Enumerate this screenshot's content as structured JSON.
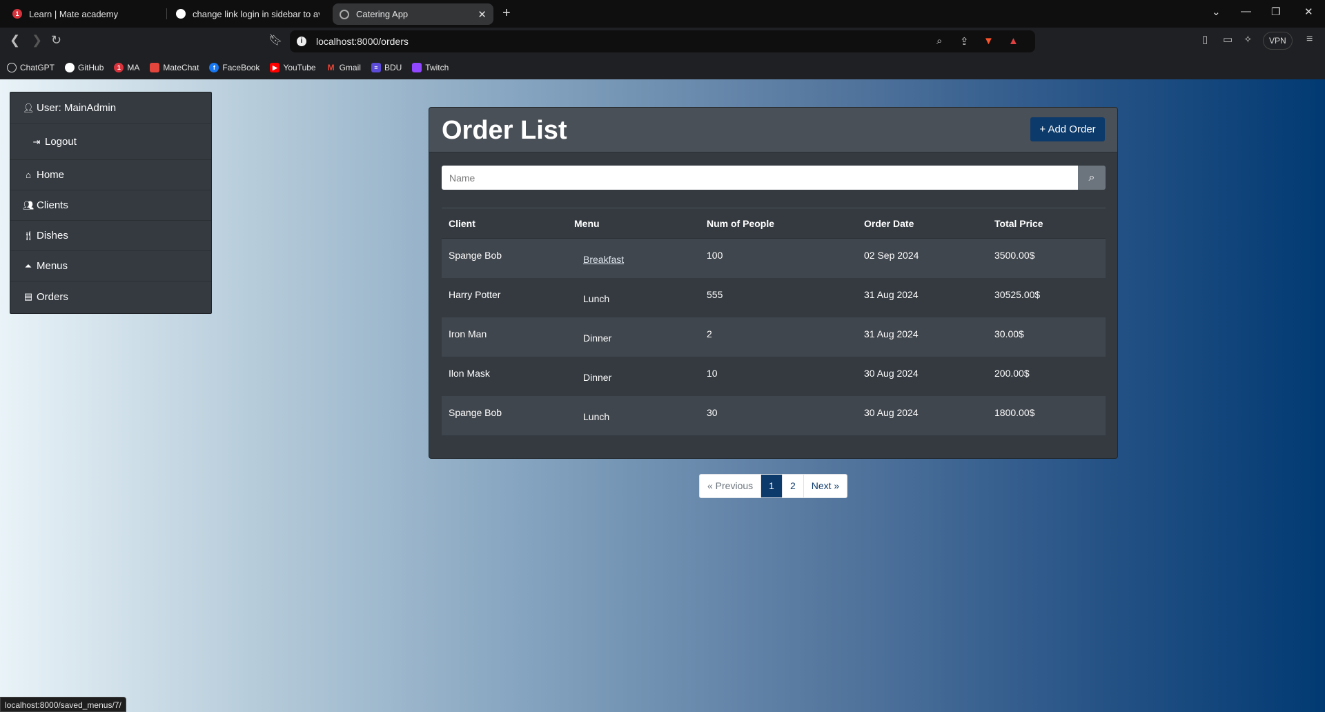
{
  "browser": {
    "tabs": [
      {
        "title": "Learn | Mate academy",
        "badge": "1",
        "active": false
      },
      {
        "title": "change link login in sidebar to avoid",
        "active": false
      },
      {
        "title": "Catering App",
        "active": true
      }
    ],
    "url": "localhost:8000/orders",
    "vpn_label": "VPN",
    "bookmarks": [
      {
        "label": "ChatGPT",
        "icon": "chatgpt-icon"
      },
      {
        "label": "GitHub",
        "icon": "github-icon"
      },
      {
        "label": "MA",
        "icon": "mate-academy-icon",
        "badge": "1"
      },
      {
        "label": "MateChat",
        "icon": "matechat-icon"
      },
      {
        "label": "FaceBook",
        "icon": "facebook-icon"
      },
      {
        "label": "YouTube",
        "icon": "youtube-icon"
      },
      {
        "label": "Gmail",
        "icon": "gmail-icon"
      },
      {
        "label": "BDU",
        "icon": "bdu-icon"
      },
      {
        "label": "Twitch",
        "icon": "twitch-icon"
      }
    ],
    "status_url": "localhost:8000/saved_menus/7/"
  },
  "sidebar": {
    "user": "User: MainAdmin",
    "logout": "Logout",
    "items": [
      {
        "label": "Home",
        "icon": "home-icon"
      },
      {
        "label": "Clients",
        "icon": "users-icon"
      },
      {
        "label": "Dishes",
        "icon": "utensils-icon"
      },
      {
        "label": "Menus",
        "icon": "cloche-icon"
      },
      {
        "label": "Orders",
        "icon": "receipt-icon"
      }
    ]
  },
  "main": {
    "title": "Order List",
    "add_button": "Add Order",
    "search_placeholder": "Name",
    "columns": [
      "Client",
      "Menu",
      "Num of People",
      "Order Date",
      "Total Price"
    ],
    "rows": [
      {
        "client": "Spange Bob",
        "menu": "Breakfast",
        "menu_link": true,
        "people": "100",
        "date": "02 Sep 2024",
        "price": "3500.00$"
      },
      {
        "client": "Harry Potter",
        "menu": "Lunch",
        "menu_link": false,
        "people": "555",
        "date": "31 Aug 2024",
        "price": "30525.00$"
      },
      {
        "client": "Iron Man",
        "menu": "Dinner",
        "menu_link": false,
        "people": "2",
        "date": "31 Aug 2024",
        "price": "30.00$"
      },
      {
        "client": "Ilon Mask",
        "menu": "Dinner",
        "menu_link": false,
        "people": "10",
        "date": "30 Aug 2024",
        "price": "200.00$"
      },
      {
        "client": "Spange Bob",
        "menu": "Lunch",
        "menu_link": false,
        "people": "30",
        "date": "30 Aug 2024",
        "price": "1800.00$"
      }
    ]
  },
  "pagination": {
    "previous": "« Previous",
    "pages": [
      "1",
      "2"
    ],
    "current": "1",
    "next": "Next »"
  },
  "colors": {
    "accent": "#0c3a6b",
    "card": "#343a40",
    "card_header": "#4a5058"
  }
}
